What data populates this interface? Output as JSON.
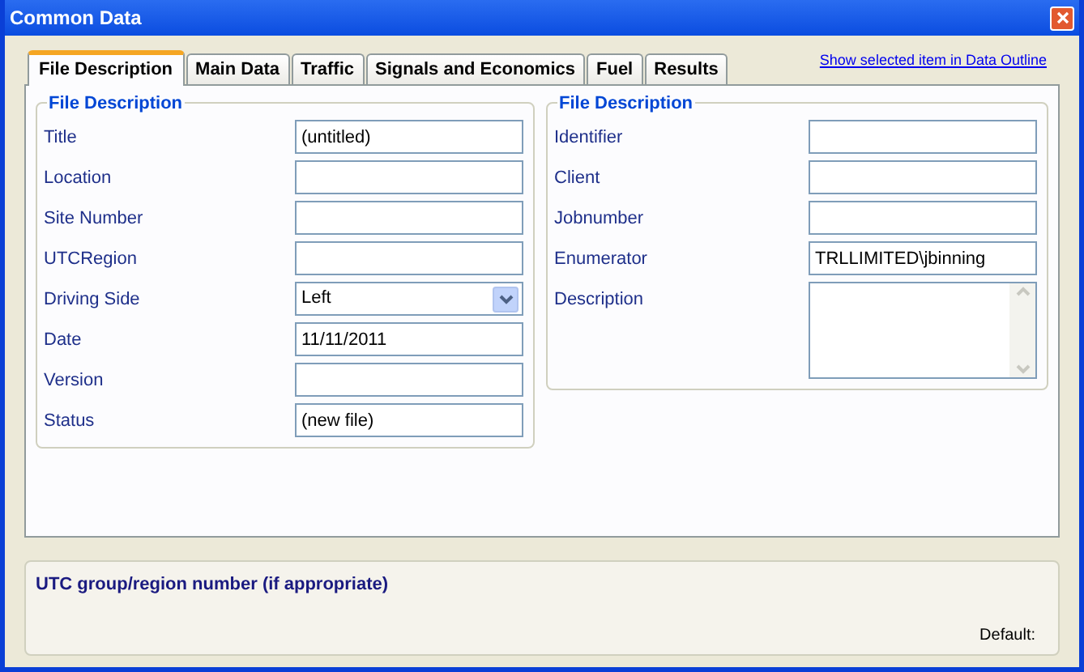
{
  "window": {
    "title": "Common Data"
  },
  "tabs": [
    {
      "label": "File Description",
      "selected": true
    },
    {
      "label": "Main Data",
      "selected": false
    },
    {
      "label": "Traffic",
      "selected": false
    },
    {
      "label": "Signals and Economics",
      "selected": false
    },
    {
      "label": "Fuel",
      "selected": false
    },
    {
      "label": "Results",
      "selected": false
    }
  ],
  "outline_link": "Show selected item in Data Outline",
  "groups": [
    {
      "title": "File Description",
      "fields": [
        {
          "label": "Title",
          "kind": "text",
          "value": "(untitled)"
        },
        {
          "label": "Location",
          "kind": "text"
        },
        {
          "label": "Site Number",
          "kind": "text"
        },
        {
          "label": "UTCRegion",
          "kind": "text"
        },
        {
          "label": "Driving Side",
          "kind": "dropdown",
          "value": "Left"
        },
        {
          "label": "Date",
          "kind": "text",
          "value": "11/11/2011"
        },
        {
          "label": "Version",
          "kind": "text"
        },
        {
          "label": "Status",
          "kind": "text",
          "value": "(new file)"
        }
      ]
    },
    {
      "title": "File Description",
      "fields": [
        {
          "label": "Identifier",
          "kind": "text"
        },
        {
          "label": "Client",
          "kind": "text"
        },
        {
          "label": "Jobnumber",
          "kind": "text"
        },
        {
          "label": "Enumerator",
          "kind": "text",
          "value": "TRLLIMITED\\jbinning"
        },
        {
          "label": "Description",
          "kind": "textarea"
        }
      ]
    }
  ],
  "help": {
    "title": "UTC group/region number (if appropriate)",
    "default_label": "Default:"
  }
}
